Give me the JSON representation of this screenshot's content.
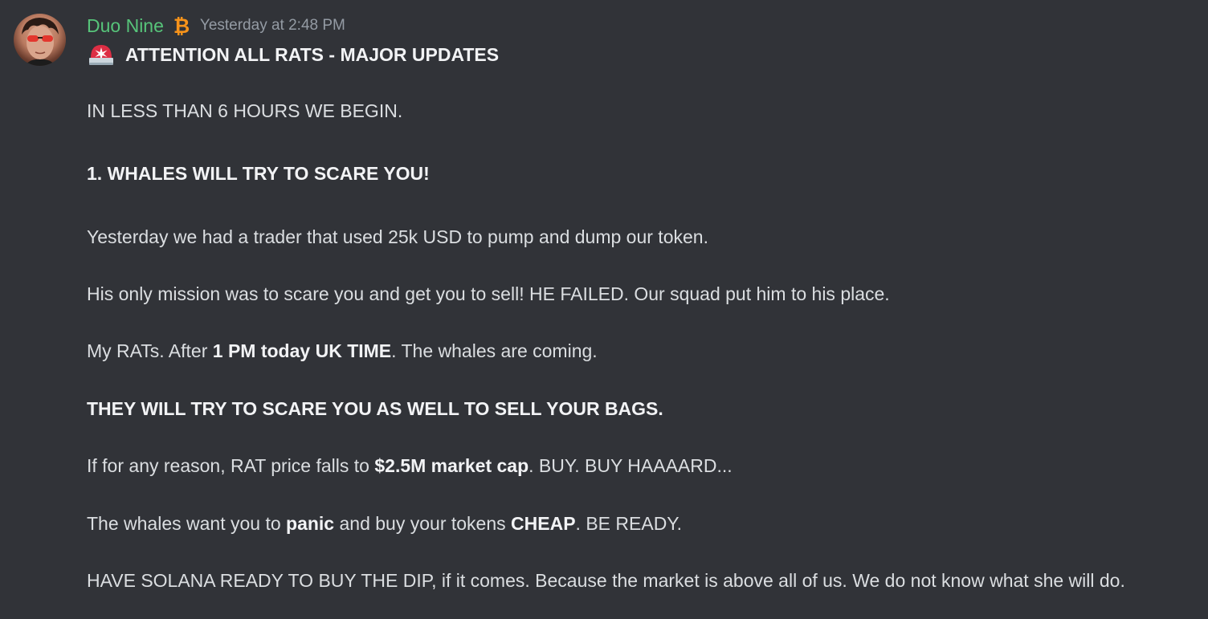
{
  "message": {
    "username": "Duo Nine",
    "timestamp": "Yesterday at 2:48 PM",
    "role_icon": "bitcoin-icon",
    "title_emoji": "rotating-light-icon",
    "title": "ATTENTION ALL RATS - MAJOR UPDATES",
    "colors": {
      "background": "#313338",
      "username": "#57c47a",
      "timestamp": "#949ba4",
      "text": "#dbdee1",
      "bitcoin": "#f7931a",
      "siren": "#dd2e44"
    },
    "lines": {
      "l1": "IN LESS THAN 6 HOURS WE BEGIN.",
      "l2": "1. WHALES WILL TRY TO SCARE YOU!",
      "l3": "Yesterday we had a trader that used 25k USD to pump and dump our token.",
      "l4": "His only mission was to scare you and get you to sell! HE FAILED. Our squad put him to his place.",
      "l5_pre": "My RATs. After ",
      "l5_bold": "1 PM today UK TIME",
      "l5_post": ". The whales are coming.",
      "l6": "THEY WILL TRY TO SCARE YOU AS WELL TO SELL YOUR BAGS.",
      "l7_pre": "If for any reason, RAT price falls to ",
      "l7_bold": "$2.5M market cap",
      "l7_post": ". BUY. BUY HAAAARD...",
      "l8_pre": "The whales want you to ",
      "l8_bold1": "panic",
      "l8_mid": " and buy your tokens ",
      "l8_bold2": "CHEAP",
      "l8_post": ". BE READY.",
      "l9": "HAVE SOLANA READY TO BUY THE DIP, if it comes. Because the market is above all of us. We do not know what she will do."
    }
  }
}
